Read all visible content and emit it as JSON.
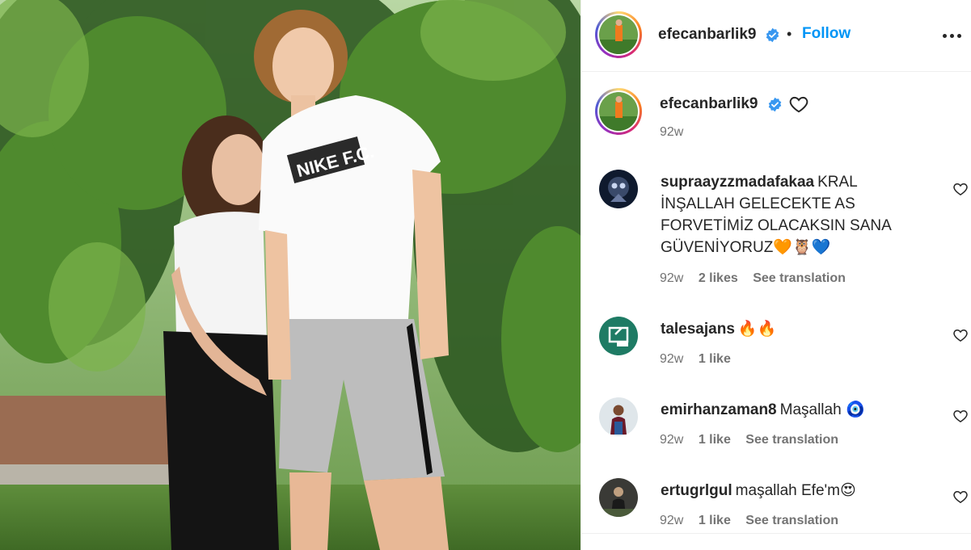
{
  "post": {
    "author": "efecanbarlik9",
    "verified": true,
    "follow_label": "Follow",
    "separator": "•",
    "more_icon": "more-horizontal-icon"
  },
  "caption": {
    "author": "efecanbarlik9",
    "time": "92w"
  },
  "comments": [
    {
      "username": "supraayzzmadafakaa",
      "text": "KRAL İNŞALLAH GELECEKTE AS FORVETİMİZ OLACAKSIN SANA GÜVENİYORUZ🧡🦉💙",
      "time": "92w",
      "likes": "2 likes",
      "translation": "See translation"
    },
    {
      "username": "talesajans",
      "text": "🔥🔥",
      "time": "92w",
      "likes": "1 like",
      "translation": ""
    },
    {
      "username": "emirhanzaman8",
      "text": "Maşallah 🧿",
      "time": "92w",
      "likes": "1 like",
      "translation": "See translation"
    },
    {
      "username": "ertugrlgul",
      "text": "maşallah Efe'm😍",
      "time": "92w",
      "likes": "1 like",
      "translation": "See translation"
    }
  ],
  "photo": {
    "shirt_text": "NIKE F.C."
  },
  "colors": {
    "accent": "#0095f6",
    "verified": "#3897f0",
    "text": "#262626",
    "muted": "#737373"
  }
}
